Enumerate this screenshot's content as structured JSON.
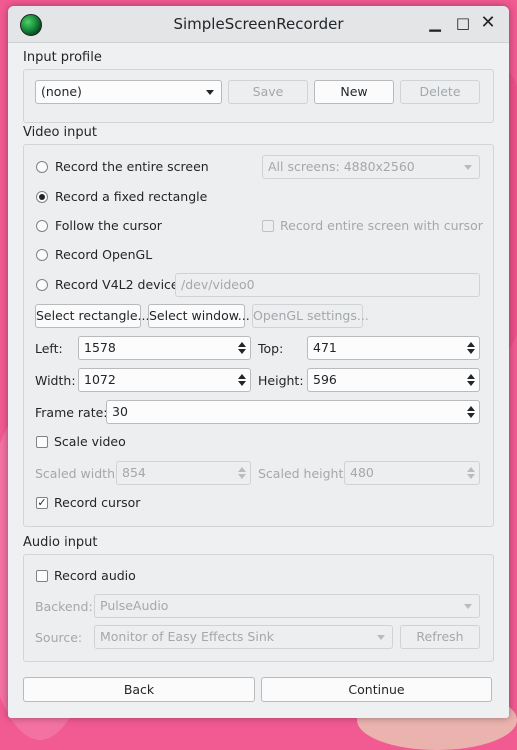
{
  "window": {
    "title": "SimpleScreenRecorder"
  },
  "input_profile": {
    "label": "Input profile",
    "selected": "(none)",
    "save": "Save",
    "new": "New",
    "delete": "Delete"
  },
  "video_input": {
    "label": "Video input",
    "options": {
      "entire_screen": "Record the entire screen",
      "fixed_rectangle": "Record a fixed rectangle",
      "follow_cursor": "Follow the cursor",
      "opengl": "Record OpenGL",
      "v4l2": "Record V4L2 device"
    },
    "selected_option": "fixed_rectangle",
    "screens_combo": "All screens: 4880x2560",
    "record_entire_screen_with_cursor": "Record entire screen with cursor",
    "v4l2_path": "/dev/video0",
    "select_rectangle": "Select rectangle...",
    "select_window": "Select window...",
    "opengl_settings": "OpenGL settings...",
    "left_label": "Left:",
    "left": "1578",
    "top_label": "Top:",
    "top": "471",
    "width_label": "Width:",
    "width": "1072",
    "height_label": "Height:",
    "height": "596",
    "frame_rate_label": "Frame rate:",
    "frame_rate": "30",
    "scale_video": "Scale video",
    "scale_video_checked": false,
    "scaled_width_label": "Scaled width:",
    "scaled_width": "854",
    "scaled_height_label": "Scaled height:",
    "scaled_height": "480",
    "record_cursor": "Record cursor",
    "record_cursor_checked": true
  },
  "audio_input": {
    "label": "Audio input",
    "record_audio": "Record audio",
    "record_audio_checked": false,
    "backend_label": "Backend:",
    "backend": "PulseAudio",
    "source_label": "Source:",
    "source": "Monitor of Easy Effects Sink",
    "refresh": "Refresh"
  },
  "footer": {
    "back": "Back",
    "continue": "Continue"
  },
  "icons": {
    "check_glyph": "✓",
    "close_glyph": "✕",
    "maximize_glyph": "□",
    "minimize_glyph": "▁"
  }
}
